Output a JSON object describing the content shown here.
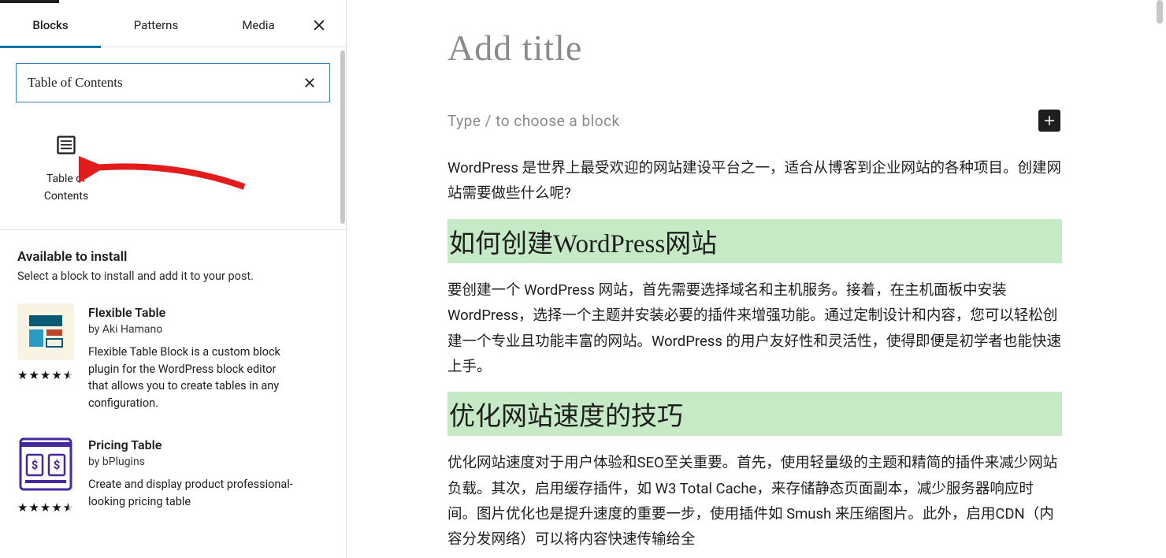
{
  "sidebar": {
    "tabs": {
      "blocks": "Blocks",
      "patterns": "Patterns",
      "media": "Media"
    },
    "search_value": "Table of Contents",
    "block_result": {
      "label_line1": "Table of",
      "label_line2": "Contents"
    },
    "available": {
      "title": "Available to install",
      "subtitle": "Select a block to install and add it to your post."
    },
    "plugins": [
      {
        "name": "Flexible Table",
        "author": "by Aki Hamano",
        "desc": "Flexible Table Block is a custom block plugin for the WordPress block editor that allows you to create tables in any configuration."
      },
      {
        "name": "Pricing Table",
        "author": "by bPlugins",
        "desc": "Create and display product professional-looking pricing table"
      }
    ]
  },
  "editor": {
    "title_placeholder": "Add title",
    "paragraph_hint": "Type / to choose a block",
    "p1": "WordPress 是世界上最受欢迎的网站建设平台之一，适合从博客到企业网站的各种项目。创建网站需要做些什么呢?",
    "h2a": "如何创建WordPress网站",
    "p2": "要创建一个 WordPress 网站，首先需要选择域名和主机服务。接着，在主机面板中安装 WordPress，选择一个主题并安装必要的插件来增强功能。通过定制设计和内容，您可以轻松创建一个专业且功能丰富的网站。WordPress 的用户友好性和灵活性，使得即便是初学者也能快速上手。",
    "h2b": "优化网站速度的技巧",
    "p3": "优化网站速度对于用户体验和SEO至关重要。首先，使用轻量级的主题和精简的插件来减少网站负载。其次，启用缓存插件，如 W3 Total Cache，来存储静态页面副本，减少服务器响应时间。图片优化也是提升速度的重要一步，使用插件如 Smush 来压缩图片。此外，启用CDN（内容分发网络）可以将内容快速传输给全"
  }
}
